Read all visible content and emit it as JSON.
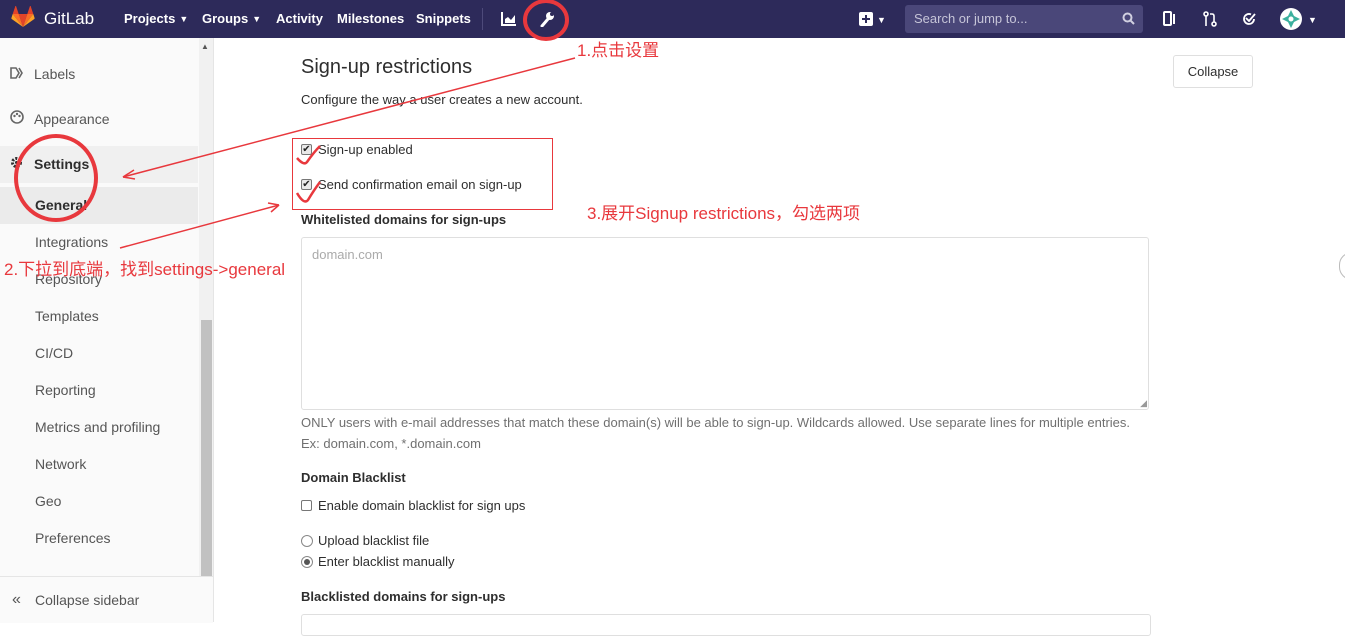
{
  "navbar": {
    "brand": "GitLab",
    "menu": [
      "Projects",
      "Groups",
      "Activity",
      "Milestones",
      "Snippets"
    ],
    "search_placeholder": "Search or jump to...",
    "colors": {
      "background": "#2d2a5a",
      "logo": "#e24329"
    }
  },
  "sidebar": {
    "items": [
      {
        "label": "Labels",
        "icon": "labels-icon"
      },
      {
        "label": "Appearance",
        "icon": "appearance-icon"
      },
      {
        "label": "Settings",
        "icon": "settings-icon"
      }
    ],
    "sub_items": [
      "General",
      "Integrations",
      "Repository",
      "Templates",
      "CI/CD",
      "Reporting",
      "Metrics and profiling",
      "Network",
      "Geo",
      "Preferences"
    ],
    "collapse_label": "Collapse sidebar"
  },
  "main": {
    "section_title": "Sign-up restrictions",
    "section_desc": "Configure the way a user creates a new account.",
    "collapse_button": "Collapse",
    "signup_enabled_label": "Sign-up enabled",
    "confirmation_label": "Send confirmation email on sign-up",
    "whitelist_label": "Whitelisted domains for sign-ups",
    "whitelist_placeholder": "domain.com",
    "whitelist_help": "ONLY users with e-mail addresses that match these domain(s) will be able to sign-up. Wildcards allowed. Use separate lines for multiple entries. Ex: domain.com, *.domain.com",
    "blacklist_heading": "Domain Blacklist",
    "blacklist_enable_label": "Enable domain blacklist for sign ups",
    "upload_radio_label": "Upload blacklist file",
    "manual_radio_label": "Enter blacklist manually",
    "blacklisted_label": "Blacklisted domains for sign-ups"
  },
  "annotations": {
    "step1": "1.点击设置",
    "step2": "2.下拉到底端，找到settings->general",
    "step3": "3.展开Signup restrictions，勾选两项",
    "color": "#e8383d"
  }
}
